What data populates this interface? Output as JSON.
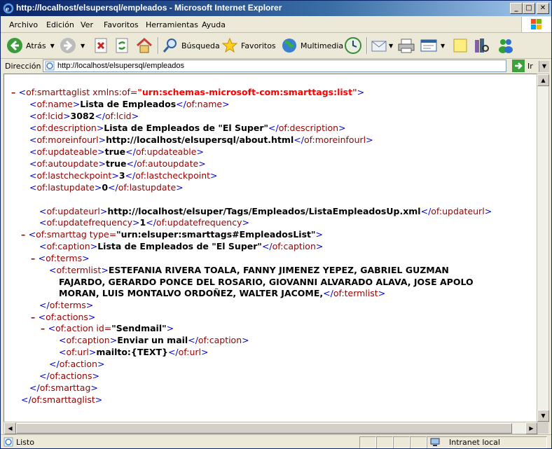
{
  "window": {
    "title": "http://localhost/elsupersql/empleados - Microsoft Internet Explorer"
  },
  "menu": {
    "items": [
      "Archivo",
      "Edición",
      "Ver",
      "Favoritos",
      "Herramientas",
      "Ayuda"
    ]
  },
  "toolbar": {
    "back": "Atrás",
    "search": "Búsqueda",
    "favorites": "Favoritos",
    "media": "Multimedia"
  },
  "address": {
    "label": "Dirección",
    "url": "http://localhost/elsupersql/empleados",
    "go": "Ir"
  },
  "xml": {
    "lines": [
      {
        "text_open": "<",
        "ns": "of:smarttaglist",
        "attr": " xmlns:of=",
        "attrval": "\"urn:schemas-microsoft-com:smarttags:list\"",
        "close": ">"
      },
      {
        "el": "of:name",
        "value": "Lista de Empleados"
      },
      {
        "el": "of:lcid",
        "value": "3082"
      },
      {
        "el": "of:description",
        "value": "Lista de Empleados de \"El Super\""
      },
      {
        "el": "of:moreinfourl",
        "value": "http://localhost/elsupersql/about.html"
      },
      {
        "el": "of:updateable",
        "value": "true"
      },
      {
        "el": "of:autoupdate",
        "value": "true"
      },
      {
        "el": "of:lastcheckpoint",
        "value": "3"
      },
      {
        "el": "of:lastupdate",
        "value": "0"
      },
      {
        "el": "of:updateurl",
        "value": "http://localhost/elsuper/Tags/Empleados/ListaEmpleadosUp.xml"
      },
      {
        "el": "of:updatefrequency",
        "value": "1"
      },
      {
        "el": "of:smarttag",
        "attr": " type=",
        "attrval": "\"urn:elsuper:smarttags#EmpleadosList\""
      },
      {
        "el": "of:caption",
        "value": "Lista de Empleados de \"El Super\""
      },
      {
        "el": "of:terms"
      },
      {
        "el": "of:termlist",
        "value_lines": [
          "ESTEFANIA RIVERA TOALA, FANNY JIMENEZ YEPEZ, GABRIEL GUZMAN",
          "FAJARDO, GERARDO PONCE DEL ROSARIO, GIOVANNI ALVARADO ALAVA, JOSE APOLO",
          "MORAN, LUIS MONTALVO ORDOÑEZ, WALTER JACOME,"
        ]
      },
      {
        "el": "of:actions"
      },
      {
        "el": "of:action",
        "attr": " id=",
        "attrval": "\"Sendmail\""
      },
      {
        "el": "of:caption",
        "value": "Enviar un mail"
      },
      {
        "el": "of:url",
        "value": "mailto:{TEXT}"
      }
    ]
  },
  "status": {
    "text": "Listo",
    "zone": "Intranet local"
  }
}
